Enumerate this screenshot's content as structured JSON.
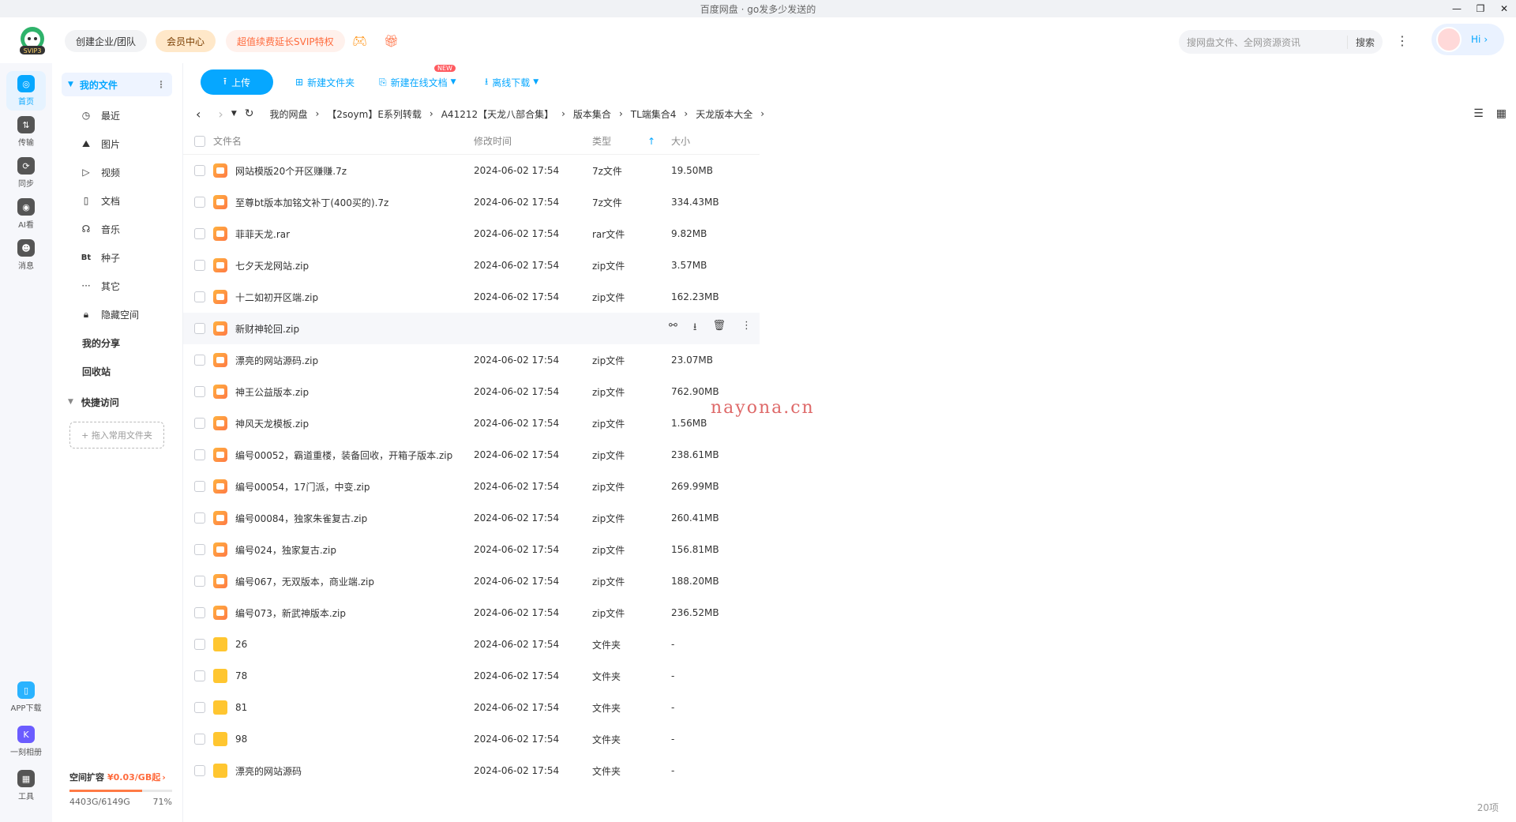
{
  "window": {
    "title": "百度网盘 · go发多少发送的"
  },
  "top": {
    "logo_label": "SVIP3",
    "enterprise": "创建企业/团队",
    "member": "会员中心",
    "promo": "超值续费延长SVIP特权",
    "search_placeholder": "搜网盘文件、全网资源资讯",
    "search_btn": "搜索",
    "hi": "Hi"
  },
  "rail": [
    "首页",
    "传输",
    "同步",
    "AI看",
    "消息"
  ],
  "rail_bottom": [
    "APP下载",
    "一刻相册",
    "工具"
  ],
  "sidebar": {
    "my_files": "我的文件",
    "items": [
      {
        "icon": "clock-icon",
        "glyph": "◷",
        "label": "最近"
      },
      {
        "icon": "image-icon",
        "glyph": "⛰",
        "label": "图片"
      },
      {
        "icon": "video-icon",
        "glyph": "▷",
        "label": "视频"
      },
      {
        "icon": "doc-icon",
        "glyph": "▯",
        "label": "文档"
      },
      {
        "icon": "music-icon",
        "glyph": "☊",
        "label": "音乐"
      },
      {
        "icon": "bt-icon",
        "glyph": "Bt",
        "label": "种子"
      },
      {
        "icon": "more-icon",
        "glyph": "···",
        "label": "其它"
      },
      {
        "icon": "lock-icon",
        "glyph": "🔒︎",
        "label": "隐藏空间"
      }
    ],
    "my_share": "我的分享",
    "recycle": "回收站",
    "quick_access": "快捷访问",
    "drag_hint": "+ 拖入常用文件夹",
    "quota_title": "空间扩容",
    "quota_price": "¥0.03/GB起",
    "quota_used": "4403G/6149G",
    "quota_pct": "71%",
    "quota_fraction": 0.71
  },
  "toolbar": {
    "upload": "上传",
    "new_folder": "新建文件夹",
    "new_doc": "新建在线文档",
    "new_badge": "NEW",
    "offline": "离线下载"
  },
  "breadcrumbs": [
    "我的网盘",
    "【2soym】E系列转载",
    "A41212【天龙八部合集】",
    "版本集合",
    "TL端集合4",
    "天龙版本大全"
  ],
  "table": {
    "headers": {
      "name": "文件名",
      "time": "修改时间",
      "type": "类型",
      "size": "大小"
    },
    "rows": [
      {
        "name": "网站模版20个开区赚赚.7z",
        "time": "2024-06-02 17:54",
        "type": "7z文件",
        "size": "19.50MB",
        "kind": "zip"
      },
      {
        "name": "至尊bt版本加铭文补丁(400买的).7z",
        "time": "2024-06-02 17:54",
        "type": "7z文件",
        "size": "334.43MB",
        "kind": "zip"
      },
      {
        "name": "菲菲天龙.rar",
        "time": "2024-06-02 17:54",
        "type": "rar文件",
        "size": "9.82MB",
        "kind": "zip"
      },
      {
        "name": "七夕天龙网站.zip",
        "time": "2024-06-02 17:54",
        "type": "zip文件",
        "size": "3.57MB",
        "kind": "zip"
      },
      {
        "name": "十二如初开区端.zip",
        "time": "2024-06-02 17:54",
        "type": "zip文件",
        "size": "162.23MB",
        "kind": "zip"
      },
      {
        "name": "新财神轮回.zip",
        "time": "",
        "type": "",
        "size": "",
        "kind": "zip",
        "hover": true
      },
      {
        "name": "漂亮的网站源码.zip",
        "time": "2024-06-02 17:54",
        "type": "zip文件",
        "size": "23.07MB",
        "kind": "zip"
      },
      {
        "name": "神王公益版本.zip",
        "time": "2024-06-02 17:54",
        "type": "zip文件",
        "size": "762.90MB",
        "kind": "zip"
      },
      {
        "name": "神风天龙模板.zip",
        "time": "2024-06-02 17:54",
        "type": "zip文件",
        "size": "1.56MB",
        "kind": "zip"
      },
      {
        "name": "编号00052，霸道重楼，装备回收，开箱子版本.zip",
        "time": "2024-06-02 17:54",
        "type": "zip文件",
        "size": "238.61MB",
        "kind": "zip"
      },
      {
        "name": "编号00054，17门派，中变.zip",
        "time": "2024-06-02 17:54",
        "type": "zip文件",
        "size": "269.99MB",
        "kind": "zip"
      },
      {
        "name": "编号00084，独家朱雀复古.zip",
        "time": "2024-06-02 17:54",
        "type": "zip文件",
        "size": "260.41MB",
        "kind": "zip"
      },
      {
        "name": "编号024，独家复古.zip",
        "time": "2024-06-02 17:54",
        "type": "zip文件",
        "size": "156.81MB",
        "kind": "zip"
      },
      {
        "name": "编号067，无双版本，商业端.zip",
        "time": "2024-06-02 17:54",
        "type": "zip文件",
        "size": "188.20MB",
        "kind": "zip"
      },
      {
        "name": "编号073，新武神版本.zip",
        "time": "2024-06-02 17:54",
        "type": "zip文件",
        "size": "236.52MB",
        "kind": "zip"
      },
      {
        "name": "26",
        "time": "2024-06-02 17:54",
        "type": "文件夹",
        "size": "-",
        "kind": "folder"
      },
      {
        "name": "78",
        "time": "2024-06-02 17:54",
        "type": "文件夹",
        "size": "-",
        "kind": "folder"
      },
      {
        "name": "81",
        "time": "2024-06-02 17:54",
        "type": "文件夹",
        "size": "-",
        "kind": "folder"
      },
      {
        "name": "98",
        "time": "2024-06-02 17:54",
        "type": "文件夹",
        "size": "-",
        "kind": "folder"
      },
      {
        "name": "漂亮的网站源码",
        "time": "2024-06-02 17:54",
        "type": "文件夹",
        "size": "-",
        "kind": "folder"
      }
    ]
  },
  "footer": {
    "count": "20项"
  },
  "watermark": "nayona.cn",
  "colors": {
    "accent": "#06a7ff",
    "promo": "#ff6b3d"
  }
}
